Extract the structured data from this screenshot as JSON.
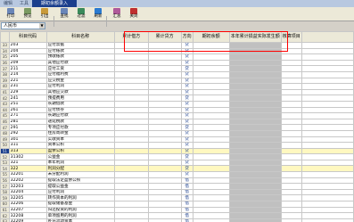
{
  "titlebar": {
    "tabs": [
      "编辑",
      "工具",
      "期初余额录入"
    ]
  },
  "toolbar": {
    "buttons": [
      {
        "label": "打印",
        "color": "#6a86b8"
      },
      {
        "label": "预览",
        "color": "#7a9a62"
      },
      {
        "label": "引出",
        "color": "#c89a3a"
      },
      {
        "label": "查找",
        "color": "#6a86b8"
      },
      {
        "label": "过滤",
        "color": "#3a8a5a"
      },
      {
        "label": "刷新",
        "color": "#2a7ad0"
      },
      {
        "label": "汇总",
        "color": "#b05a9a"
      },
      {
        "label": "关闭",
        "color": "#c03030"
      }
    ]
  },
  "filter": {
    "value": "人民币"
  },
  "grid": {
    "headers": [
      "",
      "科目代码",
      "科目名称",
      "累计借方",
      "累计贷方",
      "方向",
      "期初余额",
      "本年累计损益实际发生额",
      "核算项目"
    ],
    "rows": [
      {
        "rn": "33",
        "code": "203",
        "name": "应付票据",
        "dir": "贷"
      },
      {
        "rn": "34",
        "code": "204",
        "name": "应付账款",
        "dir": "贷"
      },
      {
        "rn": "35",
        "code": "205",
        "name": "预收账款",
        "dir": "贷"
      },
      {
        "rn": "36",
        "code": "209",
        "name": "其他应付款",
        "dir": "贷"
      },
      {
        "rn": "37",
        "code": "211",
        "name": "应付工资",
        "dir": "贷"
      },
      {
        "rn": "38",
        "code": "214",
        "name": "应付福利费",
        "dir": "贷"
      },
      {
        "rn": "39",
        "code": "221",
        "name": "应交税金",
        "dir": "贷"
      },
      {
        "rn": "40",
        "code": "231",
        "name": "应付利润",
        "dir": "贷"
      },
      {
        "rn": "41",
        "code": "229",
        "name": "其他应交款",
        "dir": "贷"
      },
      {
        "rn": "42",
        "code": "241",
        "name": "预提费用",
        "dir": "贷"
      },
      {
        "rn": "43",
        "code": "251",
        "name": "长期借款",
        "dir": "贷"
      },
      {
        "rn": "44",
        "code": "261",
        "name": "应付债券",
        "dir": "贷"
      },
      {
        "rn": "45",
        "code": "271",
        "name": "长期应付款",
        "dir": "贷"
      },
      {
        "rn": "46",
        "code": "281",
        "name": "递延税款",
        "dir": "贷"
      },
      {
        "rn": "47",
        "code": "291",
        "name": "专项应付款",
        "dir": "贷"
      },
      {
        "rn": "48",
        "code": "292",
        "name": "住房周转金",
        "dir": "贷"
      },
      {
        "rn": "49",
        "code": "301",
        "name": "实收资本",
        "dir": "贷"
      },
      {
        "rn": "50",
        "code": "311",
        "name": "资本公积",
        "dir": "贷"
      },
      {
        "rn": "51",
        "code": "313",
        "name": "盈余公积",
        "dir": "贷",
        "hl": true
      },
      {
        "rn": "52",
        "code": "31302",
        "name": "  公益金",
        "dir": "贷"
      },
      {
        "rn": "53",
        "code": "321",
        "name": "本年利润",
        "dir": "贷"
      },
      {
        "rn": "54",
        "code": "322",
        "name": "利润分配",
        "dir": "贷",
        "hl": true
      },
      {
        "rn": "55",
        "code": "32201",
        "name": "  未分配利润",
        "dir": "贷"
      },
      {
        "rn": "56",
        "code": "32202",
        "name": "  提取法定盈余公积",
        "dir": "借"
      },
      {
        "rn": "57",
        "code": "32203",
        "name": "  提取公益金",
        "dir": "借"
      },
      {
        "rn": "58",
        "code": "32204",
        "name": "  应付利润",
        "dir": "借"
      },
      {
        "rn": "59",
        "code": "32205",
        "name": "  转作资本的利润",
        "dir": "借"
      },
      {
        "rn": "60",
        "code": "32206",
        "name": "  提取储备基金",
        "dir": "借"
      },
      {
        "rn": "61",
        "code": "32207",
        "name": "  归还投资的利润",
        "dir": "借"
      },
      {
        "rn": "62",
        "code": "32208",
        "name": "  单项留用的利润",
        "dir": "借"
      },
      {
        "rn": "63",
        "code": "32209",
        "name": "  补充流动资本",
        "dir": "借"
      }
    ]
  }
}
